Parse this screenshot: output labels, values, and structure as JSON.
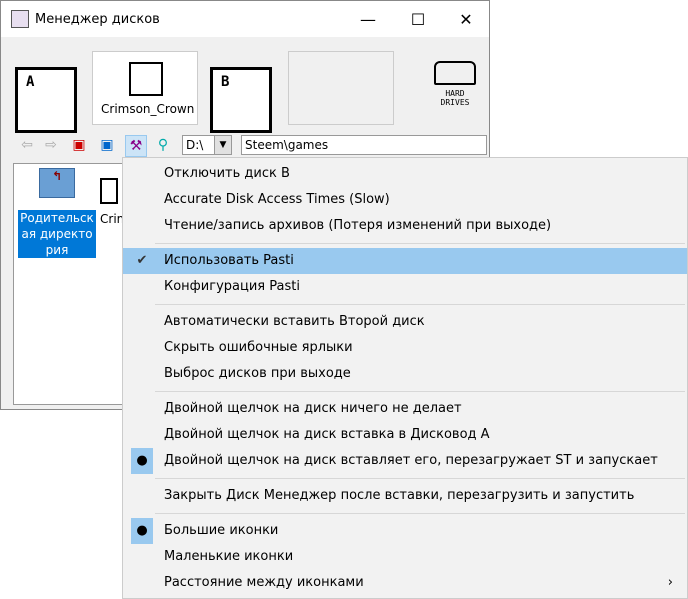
{
  "window": {
    "title": "Менеджер дисков",
    "minimize": "—",
    "maximize": "☐",
    "close": "✕"
  },
  "drives": {
    "a_letter": "A",
    "a_disk": "Crimson_Crown",
    "b_letter": "B",
    "b_disk": "",
    "hard_drives": "HARD DRIVES"
  },
  "toolbar": {
    "drive_select": "D:\\",
    "path": "Steem\\games"
  },
  "files": [
    {
      "label": "Родительская директория"
    },
    {
      "label": "Crimson_Crown"
    }
  ],
  "menu": {
    "items": [
      {
        "label": "Отключить диск B",
        "mark": ""
      },
      {
        "label": "Accurate Disk Access Times (Slow)",
        "mark": ""
      },
      {
        "label": "Чтение/запись архивов (Потеря изменений при выходе)",
        "mark": ""
      },
      {
        "sep": true
      },
      {
        "label": "Использовать Pasti",
        "mark": "✔",
        "highlight": true
      },
      {
        "label": "Конфигурация Pasti",
        "mark": ""
      },
      {
        "sep": true
      },
      {
        "label": "Автоматически вставить Второй диск",
        "mark": ""
      },
      {
        "label": "Скрыть ошибочные ярлыки",
        "mark": ""
      },
      {
        "label": "Выброс дисков при выходе",
        "mark": ""
      },
      {
        "sep": true
      },
      {
        "label": "Двойной щелчок на диск ничего не делает",
        "mark": ""
      },
      {
        "label": "Двойной щелчок на диск вставка в Дисковод А",
        "mark": ""
      },
      {
        "label": "Двойной щелчок на диск вставляет его, перезагружает ST и запускает",
        "mark": "●"
      },
      {
        "sep": true
      },
      {
        "label": "Закрыть Диск Менеджер после вставки, перезагрузить и запустить",
        "mark": ""
      },
      {
        "sep": true
      },
      {
        "label": "Большие иконки",
        "mark": "●"
      },
      {
        "label": "Маленькие иконки",
        "mark": ""
      },
      {
        "label": "Расстояние между иконками",
        "mark": "",
        "submenu": "›"
      }
    ]
  }
}
